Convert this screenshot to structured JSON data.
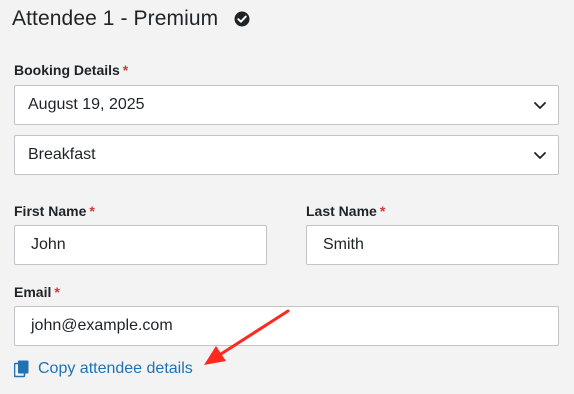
{
  "header": {
    "title": "Attendee 1 - Premium",
    "check_icon": "check-circle-icon"
  },
  "booking": {
    "label": "Booking Details",
    "required_mark": "*",
    "date_select": {
      "value": "August 19, 2025"
    },
    "meal_select": {
      "value": "Breakfast"
    }
  },
  "first_name": {
    "label": "First Name",
    "required_mark": "*",
    "value": "John"
  },
  "last_name": {
    "label": "Last Name",
    "required_mark": "*",
    "value": "Smith"
  },
  "email": {
    "label": "Email",
    "required_mark": "*",
    "value": "john@example.com"
  },
  "copy": {
    "label": "Copy attendee details",
    "icon": "copy-icon"
  },
  "annotation": {
    "color": "#ff2a1f"
  },
  "colors": {
    "link": "#2271b1",
    "required": "#d63638",
    "background": "#f3f3f4"
  }
}
